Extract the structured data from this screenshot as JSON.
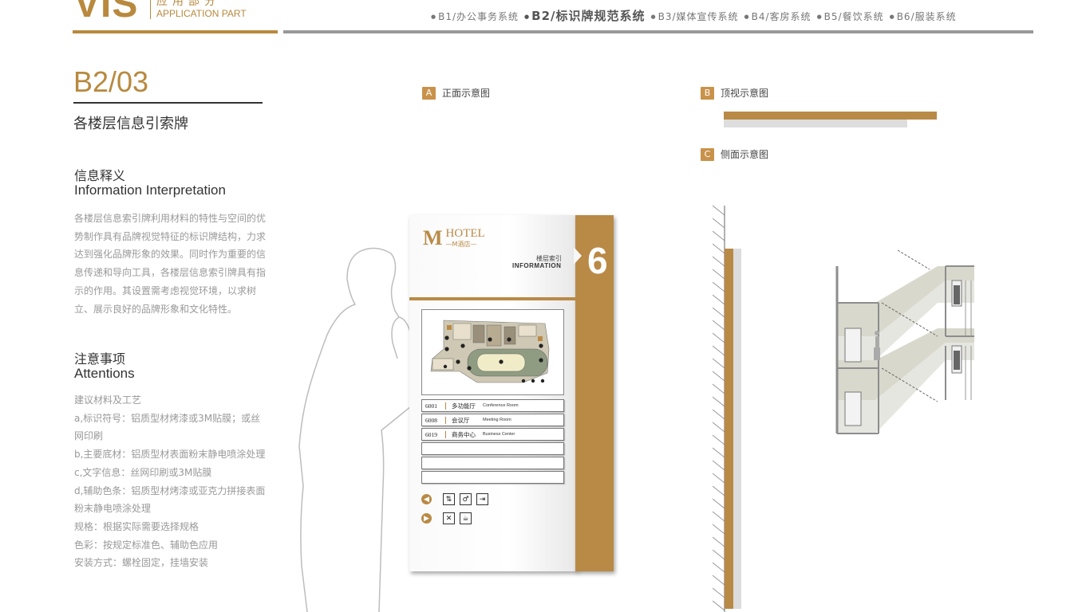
{
  "header": {
    "logo_text": "VIS",
    "part_cn": "应用部分",
    "part_en": "APPLICATION PART",
    "nav": [
      {
        "label": "B1/办公事务系统",
        "active": false
      },
      {
        "label": "B2/标识牌规范系统",
        "active": true
      },
      {
        "label": "B3/媒体宣传系统",
        "active": false
      },
      {
        "label": "B4/客房系统",
        "active": false
      },
      {
        "label": "B5/餐饮系统",
        "active": false
      },
      {
        "label": "B6/服装系统",
        "active": false
      }
    ]
  },
  "page": {
    "code": "B2/03",
    "subtitle": "各楼层信息引索牌",
    "info_title_cn": "信息释义",
    "info_title_en": "Information Interpretation",
    "info_text": "各楼层信息索引牌利用材料的特性与空间的优势制作具有品牌视觉特征的标识牌结构，力求达到强化品牌形象的效果。同时作为重要的信息传递和导向工具，各楼层信息索引牌具有指示的作用。其设置需考虑视觉环境，以求树立、展示良好的品牌形象和文化特性。",
    "attention_title_cn": "注意事项",
    "attention_title_en": "Attentions",
    "attention_items": [
      "建议材料及工艺",
      "a,标识符号：铝质型材烤漆或3M贴膜；或丝网印刷",
      "b,主要底材：铝质型材表面粉末静电喷涂处理",
      "c,文字信息：丝网印刷或3M贴膜",
      "d,辅助色条：铝质型材烤漆或亚克力拼接表面粉末静电喷涂处理",
      "规格：根据实际需要选择规格",
      "色彩：按规定标准色、辅助色应用",
      "安装方式：螺栓固定，挂墙安装"
    ]
  },
  "views": {
    "front": {
      "letter": "A",
      "label": "正面示意图"
    },
    "top": {
      "letter": "B",
      "label": "顶视示意图"
    },
    "side": {
      "letter": "C",
      "label": "侧面示意图"
    }
  },
  "sign": {
    "logo_mark": "M",
    "brand": "HOTEL",
    "brand_sub": "—M酒店—",
    "info_cn": "楼层索引",
    "info_en": "INFORMATION",
    "floor": "6",
    "rooms": [
      {
        "num": "6001",
        "cn": "多功能厅",
        "en": "Conference Room"
      },
      {
        "num": "6008",
        "cn": "会议厅",
        "en": "Meeting Room"
      },
      {
        "num": "6019",
        "cn": "商务中心",
        "en": "Business Center"
      }
    ]
  },
  "colors": {
    "brand_gold": "#b98a46",
    "rule_grey": "#999999"
  }
}
